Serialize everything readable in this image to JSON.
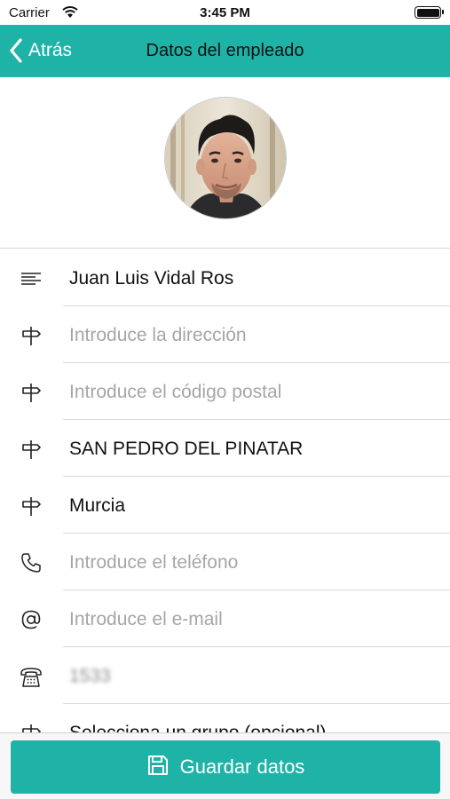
{
  "status_bar": {
    "carrier": "Carrier",
    "time": "3:45 PM"
  },
  "nav": {
    "back_label": "Atrás",
    "title": "Datos del empleado"
  },
  "colors": {
    "accent": "#1fb3a7",
    "placeholder": "#a6a6a6",
    "divider": "#d9d9d9"
  },
  "form": {
    "name": {
      "icon": "text-lines-icon",
      "value": "Juan Luis Vidal Ros"
    },
    "address": {
      "icon": "signpost-icon",
      "placeholder": "Introduce la dirección"
    },
    "postal_code": {
      "icon": "signpost-icon",
      "placeholder": "Introduce el código postal"
    },
    "city": {
      "icon": "signpost-icon",
      "value": "SAN PEDRO DEL PINATAR"
    },
    "province": {
      "icon": "signpost-icon",
      "value": "Murcia"
    },
    "phone": {
      "icon": "phone-icon",
      "placeholder": "Introduce el teléfono"
    },
    "email": {
      "icon": "at-sign-icon",
      "placeholder": "Introduce el e-mail"
    },
    "extension": {
      "icon": "desk-phone-icon",
      "value": "1533"
    },
    "group": {
      "icon": "signpost-icon",
      "placeholder": "Selecciona un grupo (opcional)"
    }
  },
  "footer": {
    "save_label": "Guardar datos",
    "save_icon": "floppy-disk-icon"
  }
}
